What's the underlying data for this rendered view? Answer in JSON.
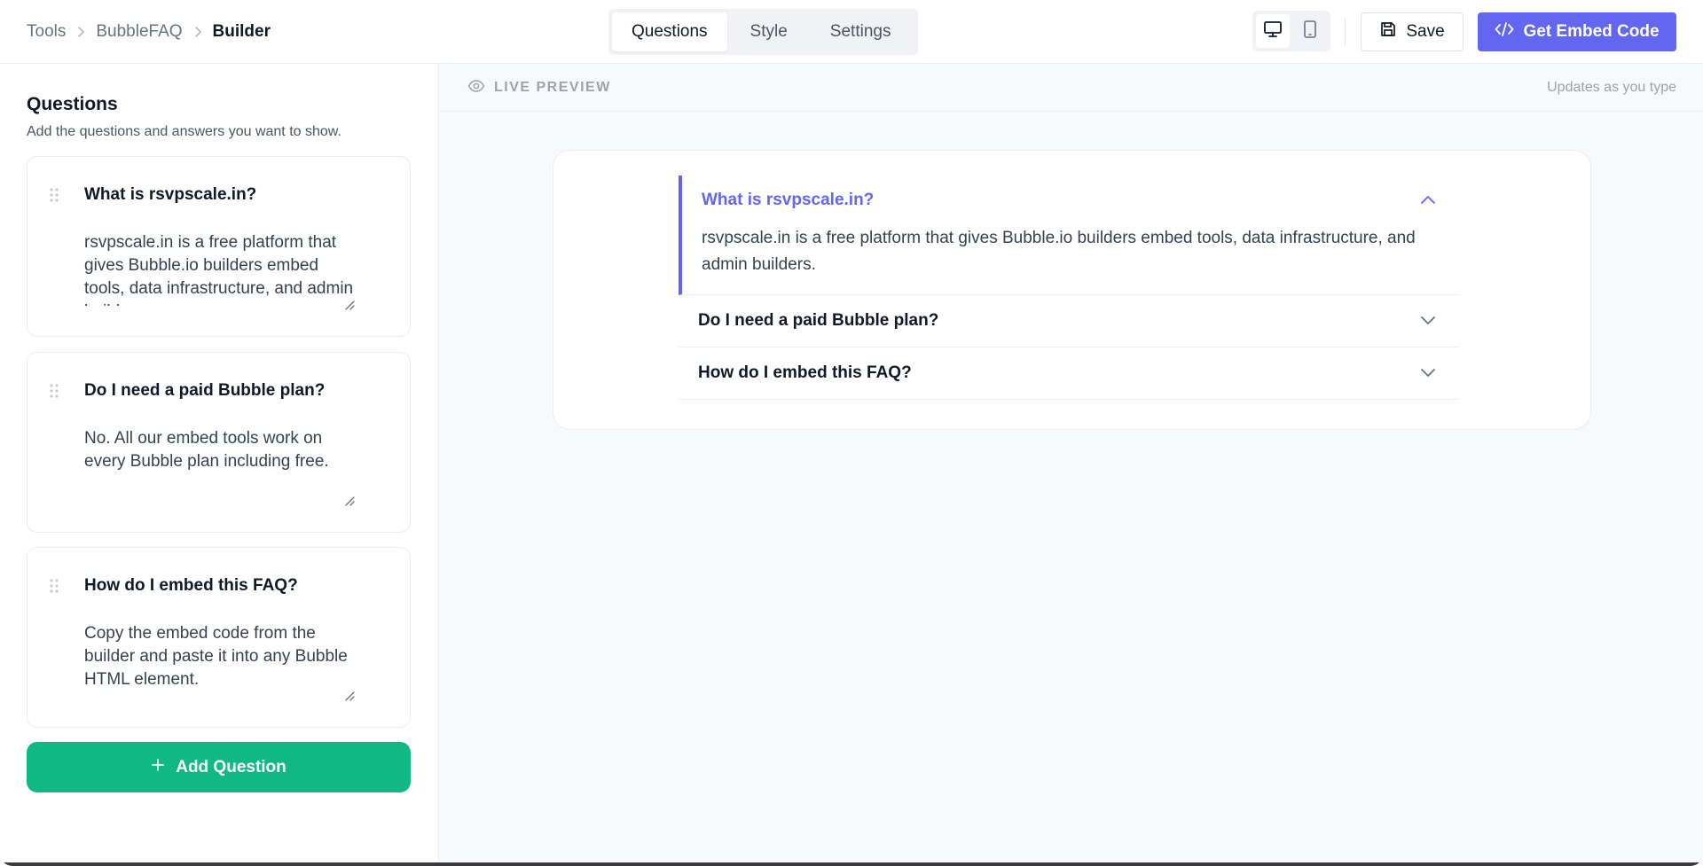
{
  "breadcrumb": {
    "items": [
      "Tools",
      "BubbleFAQ",
      "Builder"
    ]
  },
  "tabs": [
    {
      "label": "Questions",
      "active": true
    },
    {
      "label": "Style",
      "active": false
    },
    {
      "label": "Settings",
      "active": false
    }
  ],
  "toolbar": {
    "save_label": "Save",
    "embed_label": "Get Embed Code",
    "device_active": "desktop",
    "accent_color": "#6366f1"
  },
  "sidebar": {
    "title": "Questions",
    "subtitle": "Add the questions and answers you want to show.",
    "questions": [
      {
        "question": "What is rsvpscale.in?",
        "answer": "rsvpscale.in is a free platform that gives Bubble.io builders embed tools, data infrastructure, and admin builders."
      },
      {
        "question": "Do I need a paid Bubble plan?",
        "answer": "No. All our embed tools work on every Bubble plan including free."
      },
      {
        "question": "How do I embed this FAQ?",
        "answer": "Copy the embed code from the builder and paste it into any Bubble HTML element."
      }
    ],
    "add_label": "Add Question",
    "add_color": "#10b981"
  },
  "preview": {
    "live_label": "LIVE PREVIEW",
    "updates_label": "Updates as you type",
    "faq": [
      {
        "question": "What is rsvpscale.in?",
        "answer": "rsvpscale.in is a free platform that gives Bubble.io builders embed tools, data infrastructure, and admin builders.",
        "open": true
      },
      {
        "question": "Do I need a paid Bubble plan?",
        "answer": "",
        "open": false
      },
      {
        "question": "How do I embed this FAQ?",
        "answer": "",
        "open": false
      }
    ]
  }
}
